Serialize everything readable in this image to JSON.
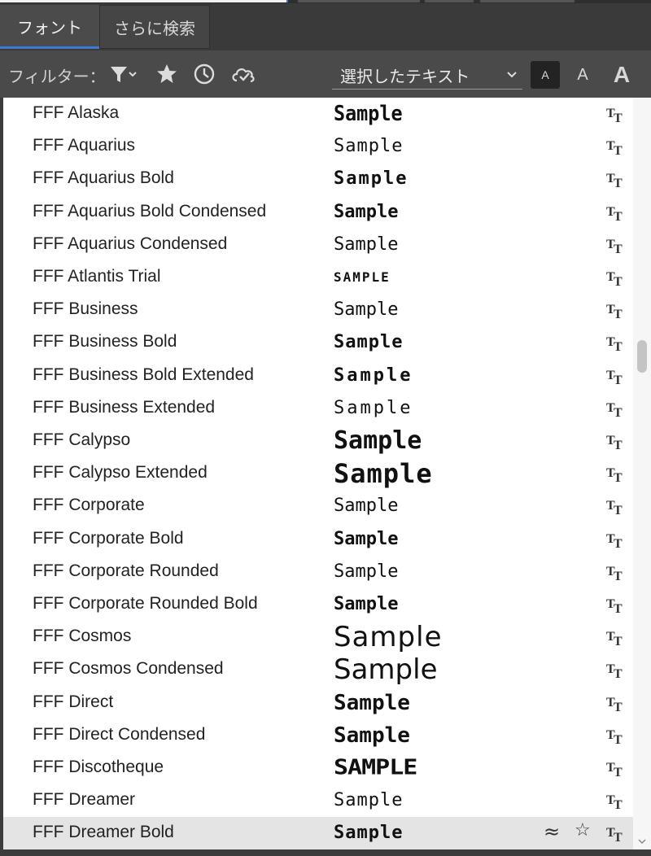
{
  "tabs": [
    {
      "label": "フォント"
    },
    {
      "label": "さらに検索"
    }
  ],
  "filterbar": {
    "label": "フィルター：",
    "filter_icon": "funnel-icon",
    "favorites_icon": "star-icon",
    "recent_icon": "clock-icon",
    "activated_icon": "cloud-check-icon",
    "preview_select": "選択したテキスト",
    "size_small": "A",
    "size_medium": "A",
    "size_large": "A"
  },
  "fonts": [
    {
      "name": "FFF Alaska",
      "sample": "Sample"
    },
    {
      "name": "FFF Aquarius",
      "sample": "Sample"
    },
    {
      "name": "FFF Aquarius Bold",
      "sample": "Sample"
    },
    {
      "name": "FFF Aquarius Bold Condensed",
      "sample": "Sample"
    },
    {
      "name": "FFF Aquarius Condensed",
      "sample": "Sample"
    },
    {
      "name": "FFF Atlantis Trial",
      "sample": "SAMPLE"
    },
    {
      "name": "FFF Business",
      "sample": "Sample"
    },
    {
      "name": "FFF Business Bold",
      "sample": "Sample"
    },
    {
      "name": "FFF Business Bold Extended",
      "sample": "Sample"
    },
    {
      "name": "FFF Business Extended",
      "sample": "Sample"
    },
    {
      "name": "FFF Calypso",
      "sample": "Sample"
    },
    {
      "name": "FFF Calypso Extended",
      "sample": "Sample"
    },
    {
      "name": "FFF Corporate",
      "sample": "Sample"
    },
    {
      "name": "FFF Corporate Bold",
      "sample": "Sample"
    },
    {
      "name": "FFF Corporate Rounded",
      "sample": "Sample"
    },
    {
      "name": "FFF Corporate Rounded Bold",
      "sample": "Sample"
    },
    {
      "name": "FFF Cosmos",
      "sample": "Sample"
    },
    {
      "name": "FFF Cosmos Condensed",
      "sample": "Sample"
    },
    {
      "name": "FFF Direct",
      "sample": "Sample"
    },
    {
      "name": "FFF Direct Condensed",
      "sample": "Sample"
    },
    {
      "name": "FFF Discotheque",
      "sample": "SAMPLE"
    },
    {
      "name": "FFF Dreamer",
      "sample": "Sample"
    },
    {
      "name": "FFF Dreamer Bold",
      "sample": "Sample"
    }
  ],
  "selected_row": {
    "similar_icon": "≈",
    "favorite_icon": "☆"
  },
  "colors": {
    "accent": "#3b7ad8",
    "panel": "#4a4a4a",
    "list_bg": "#ffffff",
    "selected_row": "#e4e4e4"
  }
}
